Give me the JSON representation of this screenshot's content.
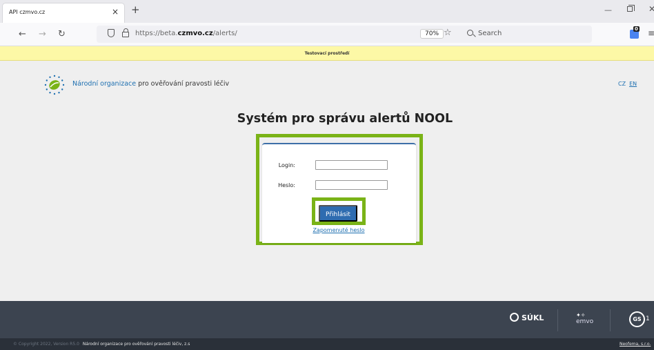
{
  "browser": {
    "tab_title": "API czmvo.cz",
    "tab_close": "×",
    "new_tab": "+",
    "url_prefix": "https://beta.",
    "url_domain": "czmvo.cz",
    "url_path": "/alerts/",
    "zoom": "70%",
    "search_placeholder": "Search",
    "extension_badge": "0"
  },
  "page": {
    "test_env_banner": "Testovací prostředí",
    "org_name_highlight": "Národní organizace",
    "org_name_rest": " pro ověřování pravosti léčiv",
    "lang_cz": "CZ",
    "lang_en": "EN",
    "title": "Systém pro správu alertů NOOL"
  },
  "login_form": {
    "login_label": "Login:",
    "login_value": "",
    "password_label": "Heslo:",
    "password_value": "",
    "submit_label": "Přihlásit",
    "forgot_link": "Zapomenuté heslo"
  },
  "footer": {
    "sukl_label": "SÚKL",
    "emvo_label": "emvo",
    "gs1_label": "GS",
    "gs1_suffix": "1",
    "copyright": "© Copyright 2022, Version R5.0",
    "org_full": "Národní organizace pro ověřování pravosti léčiv, z.s",
    "vendor": "Neofema, s.r.o."
  },
  "colors": {
    "highlight": "#7ab317",
    "primary_button": "#2e6cb0",
    "footer_bg": "#3c4450",
    "test_banner_bg": "#fdf8a6"
  }
}
